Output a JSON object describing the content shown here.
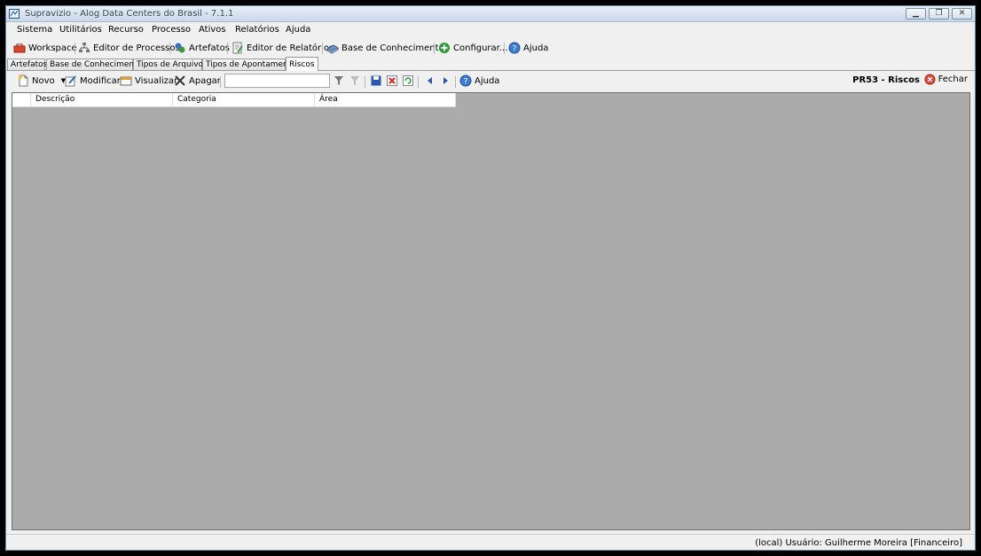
{
  "window": {
    "title": "Supravizio - Alog Data Centers do Brasil - 7.1.1",
    "controls": [
      "minimize",
      "restore",
      "close"
    ]
  },
  "menu": [
    "Sistema",
    "Utilitários",
    "Recurso",
    "Processo",
    "Ativos",
    "Relatórios",
    "Ajuda"
  ],
  "main_toolbar": {
    "workspace": "Workspace",
    "editor_processos": "Editor de Processos",
    "artefatos": "Artefatos",
    "editor_relatorios": "Editor de Relatórios",
    "base_conhecimento": "Base de Conhecimento",
    "configurar": "Configurar...",
    "ajuda": "Ajuda"
  },
  "tabs": [
    "Artefatos",
    "Base de Conhecimento",
    "Tipos de Arquivos",
    "Tipos de Apontamento",
    "Riscos"
  ],
  "active_tab": "Riscos",
  "action_toolbar": {
    "novo": "Novo",
    "modificar": "Modificar",
    "visualizar": "Visualizar",
    "apagar": "Apagar",
    "search_value": "",
    "ajuda": "Ajuda",
    "screen_code": "PR53 - Riscos",
    "fechar": "Fechar"
  },
  "grid": {
    "columns": [
      "Descrição",
      "Categoria",
      "Área"
    ],
    "rows": []
  },
  "status": {
    "text": "(local)  Usuário: Guilherme Moreira [Financeiro]"
  },
  "colors": {
    "grid_background": "#ababab",
    "window_background": "#f0f0f0"
  }
}
